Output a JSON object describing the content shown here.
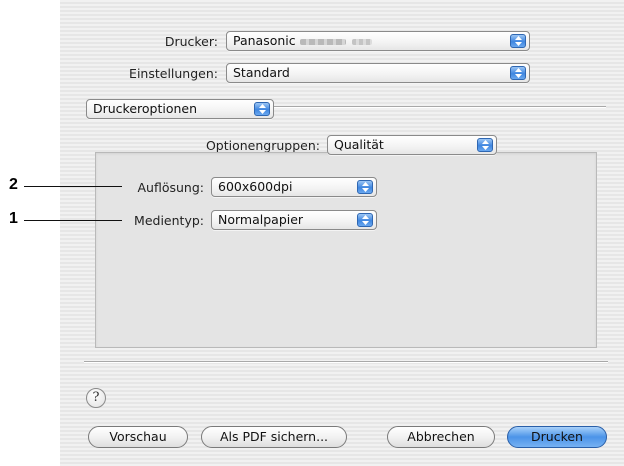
{
  "printer": {
    "label": "Drucker:",
    "value": "Panasonic"
  },
  "settings": {
    "label": "Einstellungen:",
    "value": "Standard"
  },
  "section": {
    "value": "Druckeroptionen"
  },
  "option_groups": {
    "label": "Optionengruppen:",
    "value": "Qualität"
  },
  "resolution": {
    "label": "Auflösung:",
    "value": "600x600dpi"
  },
  "media_type": {
    "label": "Medientyp:",
    "value": "Normalpapier"
  },
  "callouts": {
    "resolution_num": "2",
    "media_num": "1"
  },
  "help": {
    "symbol": "?"
  },
  "buttons": {
    "preview": "Vorschau",
    "save_pdf": "Als PDF sichern...",
    "cancel": "Abbrechen",
    "print": "Drucken"
  },
  "colors": {
    "accent": "#4c94e8",
    "stepper": "#3f86e0"
  },
  "icons": {
    "popup": "up-down-arrows-icon",
    "help": "question-mark-icon"
  }
}
